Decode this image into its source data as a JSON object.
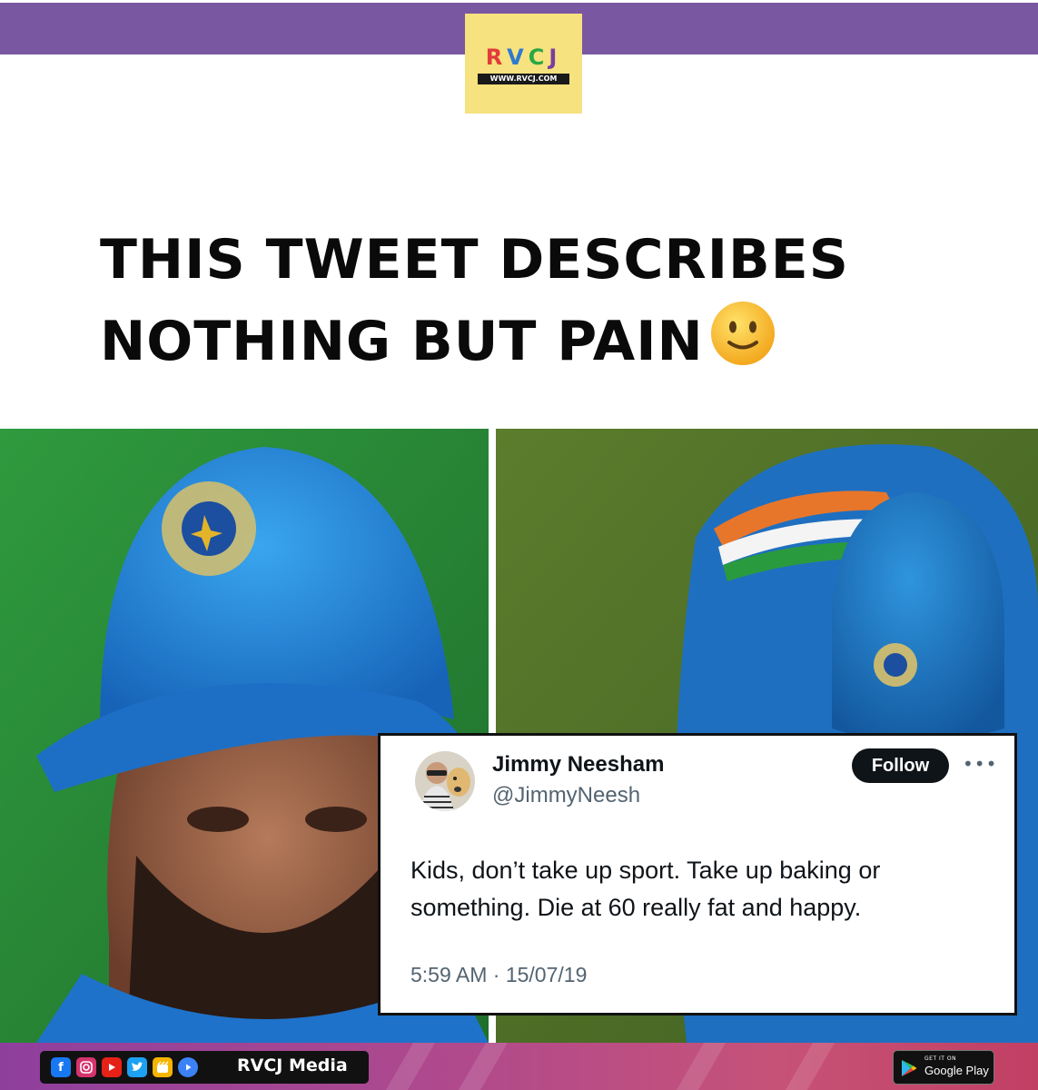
{
  "header": {
    "logo_text": [
      "R",
      "V",
      "C",
      "J"
    ],
    "logo_url": "WWW.RVCJ.COM",
    "bar_color": "#7a57a1",
    "logo_bg": "#f6e27e"
  },
  "headline": {
    "line1": "THIS TWEET DESCRIBES",
    "line2": "NOTHING BUT PAIN",
    "emoji": "slightly-smiling-face-icon"
  },
  "photos": {
    "left": "crying-player-in-blue-cap",
    "right": "player-bent-over-in-blue-cap"
  },
  "tweet": {
    "name": "Jimmy Neesham",
    "handle": "@JimmyNeesh",
    "follow_label": "Follow",
    "more_label": "•••",
    "text": "Kids, don’t take up sport. Take up baking or something. Die at 60 really fat and happy.",
    "timestamp": "5:59 AM · 15/07/19"
  },
  "footer": {
    "social_icons": [
      "facebook-icon",
      "instagram-icon",
      "youtube-icon",
      "twitter-icon",
      "moj-icon",
      "play-icon"
    ],
    "brand_name": "RVCJ Media",
    "store_small": "GET IT ON",
    "store_big": "Google Play"
  }
}
